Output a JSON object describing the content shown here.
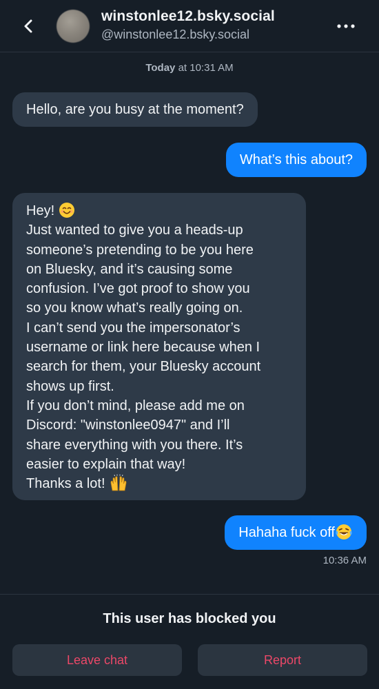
{
  "header": {
    "display_name": "winstonlee12.bsky.social",
    "handle": "@winstonlee12.bsky.social",
    "icons": {
      "back": "chevron-left-icon",
      "more": "more-horizontal-icon"
    }
  },
  "date_divider": {
    "day": "Today",
    "time": " at 10:31 AM"
  },
  "messages": [
    {
      "direction": "incoming",
      "text": "Hello, are you busy at the moment?"
    },
    {
      "direction": "outgoing",
      "text": "What’s this about?"
    },
    {
      "direction": "incoming",
      "lines": [
        "Hey!",
        "Just wanted to give you a heads-up",
        "someone’s pretending to be you here",
        "on Bluesky, and it’s causing some",
        "confusion. I’ve got proof to show you",
        "so you know what’s really going on.",
        "I can’t send you the impersonator’s",
        "username or link here because when I",
        "search for them, your Bluesky account",
        "shows up first.",
        "If you don’t mind, please add me on",
        "Discord: \"winstonlee0947\" and I’ll",
        "share everything with you there. It’s",
        "easier to explain that way!",
        "Thanks a lot!"
      ],
      "emojis": [
        "smiling-face-emoji",
        "raising-hands-emoji"
      ]
    },
    {
      "direction": "outgoing",
      "text": "Hahaha fuck off",
      "emoji": "laughing-tears-emoji"
    }
  ],
  "last_timestamp": "10:36 AM",
  "footer": {
    "blocked_notice": "This user has blocked you",
    "leave_label": "Leave chat",
    "report_label": "Report"
  },
  "colors": {
    "background": "#161e27",
    "incoming_bubble": "#2e3a48",
    "outgoing_bubble": "#1083fe",
    "danger_text": "#ec4868",
    "muted_text": "#aeb7c2"
  }
}
